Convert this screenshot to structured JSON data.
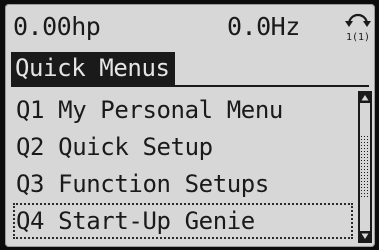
{
  "status": {
    "power": "0.00hp",
    "frequency": "0.0Hz",
    "setup_indicator": "1(1)",
    "setup_icon": "setup-cycle-icon"
  },
  "menu": {
    "title": "Quick Menus",
    "items": [
      {
        "label": "Q1 My Personal Menu"
      },
      {
        "label": "Q2 Quick Setup"
      },
      {
        "label": "Q3 Function Setups"
      },
      {
        "label": "Q4 Start-Up Genie"
      }
    ],
    "selected_index": 3
  },
  "scrollbar": {
    "position_fraction": 0.5,
    "visible_fraction": 0.5
  },
  "colors": {
    "lcd_background": "#d7d7d7",
    "pixel_dark": "#1a1a1a",
    "bezel": "#0c0c0c"
  }
}
